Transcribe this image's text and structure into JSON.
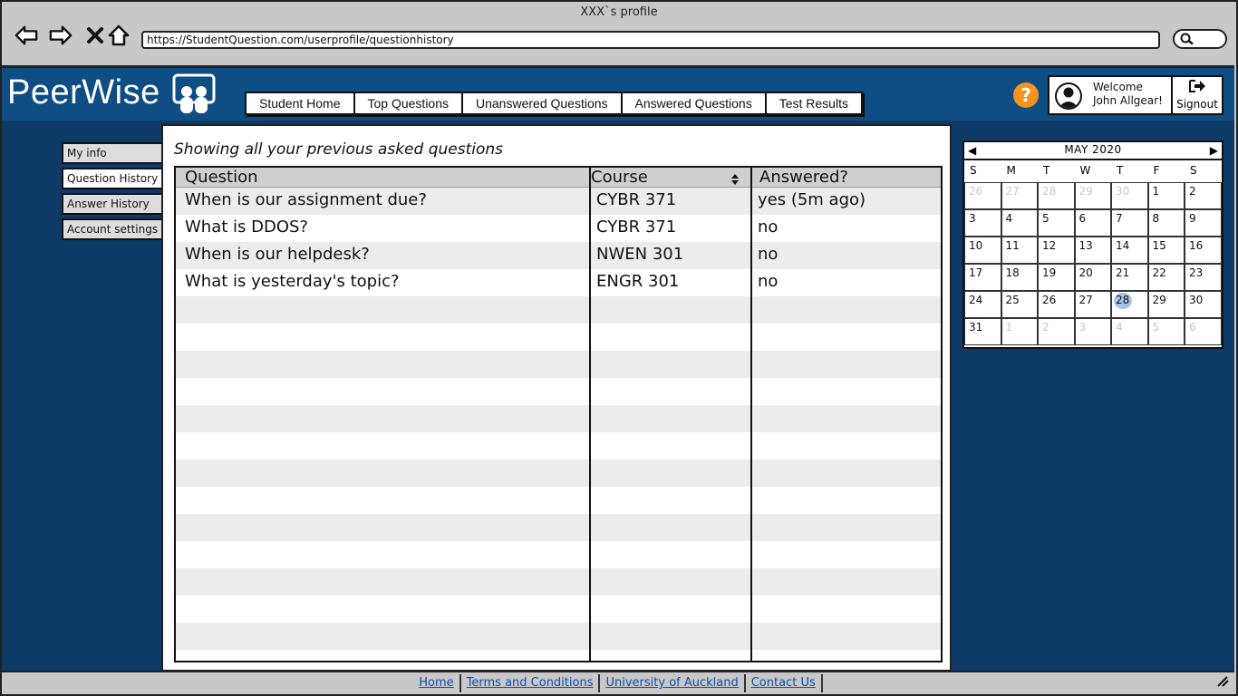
{
  "window": {
    "title": "XXX`s profile",
    "url": "https://StudentQuestion.com/userprofile/questionhistory"
  },
  "header": {
    "logo_text": "PeerWise",
    "nav": [
      "Student Home",
      "Top Questions",
      "Unanswered Questions",
      "Answered Questions",
      "Test Results"
    ],
    "help_label": "?",
    "user": {
      "welcome": "Welcome",
      "name": "John Allgear!",
      "signout": "Signout"
    }
  },
  "sidebar": {
    "items": [
      {
        "label": "My info"
      },
      {
        "label": "Question History"
      },
      {
        "label": "Answer History"
      },
      {
        "label": "Account settings"
      }
    ]
  },
  "main": {
    "caption": "Showing all your previous asked questions",
    "columns": [
      "Question",
      "Course",
      "Answered?"
    ],
    "rows": [
      {
        "question": "When is our assignment due?",
        "course": "CYBR 371",
        "answered": "yes (5m ago)"
      },
      {
        "question": "What is DDOS?",
        "course": "CYBR 371",
        "answered": "no"
      },
      {
        "question": "When is our helpdesk?",
        "course": "NWEN 301",
        "answered": "no"
      },
      {
        "question": "What is yesterday's topic?",
        "course": "ENGR 301",
        "answered": "no"
      }
    ],
    "empty_rows": 13
  },
  "calendar": {
    "month": "MAY 2020",
    "dows": [
      "S",
      "M",
      "T",
      "W",
      "T",
      "F",
      "S"
    ],
    "weeks": [
      [
        "26",
        "27",
        "28",
        "29",
        "30",
        "1",
        "2"
      ],
      [
        "3",
        "4",
        "5",
        "6",
        "7",
        "8",
        "9"
      ],
      [
        "10",
        "11",
        "12",
        "13",
        "14",
        "15",
        "16"
      ],
      [
        "17",
        "18",
        "19",
        "20",
        "21",
        "22",
        "23"
      ],
      [
        "24",
        "25",
        "26",
        "27",
        "28",
        "29",
        "30"
      ],
      [
        "31",
        "1",
        "2",
        "3",
        "4",
        "5",
        "6"
      ]
    ],
    "today": "28"
  },
  "footer": {
    "links": [
      "Home",
      "Terms and Conditions",
      "University of Auckland",
      "Contact Us"
    ]
  },
  "colors": {
    "header_bg": "#0f4d85",
    "page_bg": "#0d3a66",
    "help": "#f7931e",
    "link": "#0b4fb3",
    "today": "#a9c4ec"
  }
}
